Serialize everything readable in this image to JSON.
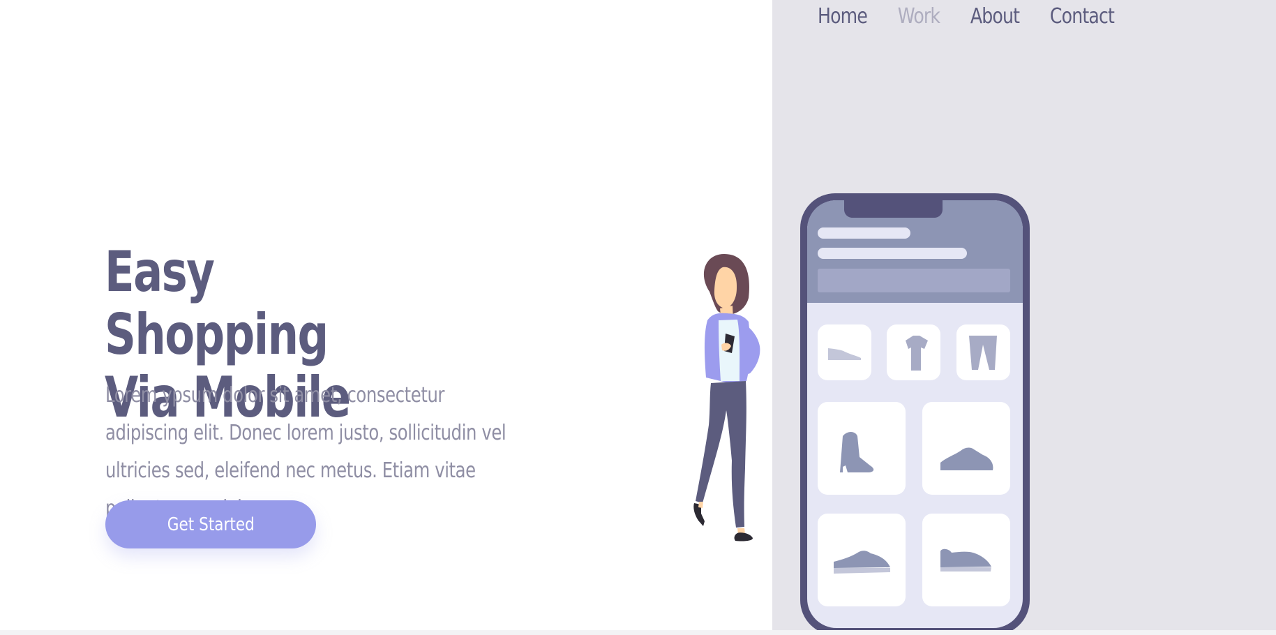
{
  "nav": {
    "items": [
      {
        "label": "Home"
      },
      {
        "label": "Work"
      },
      {
        "label": "About"
      },
      {
        "label": "Contact"
      }
    ]
  },
  "hero": {
    "title_line_1": "Easy Shopping",
    "title_line_2": "Via Mobile",
    "text": "Lorem ypsum dolor sit amet, consectetur adipiscing elit. Donec lorem justo, sollicitudin vel ultricies sed, eleifend nec metus. Etiam vitae pellentesque dolor.",
    "cta_label": "Get Started"
  },
  "colors": {
    "primary_text": "#5c5c7e",
    "muted_text": "#8f8ea4",
    "accent": "#979bea",
    "panel_bg": "#e5e4ea",
    "phone_dark": "#54527a",
    "phone_header": "#8d95b4"
  },
  "illustration": {
    "products": [
      {
        "icon": "flat-shoe-icon"
      },
      {
        "icon": "tshirt-icon"
      },
      {
        "icon": "pants-icon"
      },
      {
        "icon": "ankle-boot-icon"
      },
      {
        "icon": "sneaker-icon"
      },
      {
        "icon": "low-sneaker-icon"
      },
      {
        "icon": "slip-on-shoe-icon"
      }
    ]
  }
}
